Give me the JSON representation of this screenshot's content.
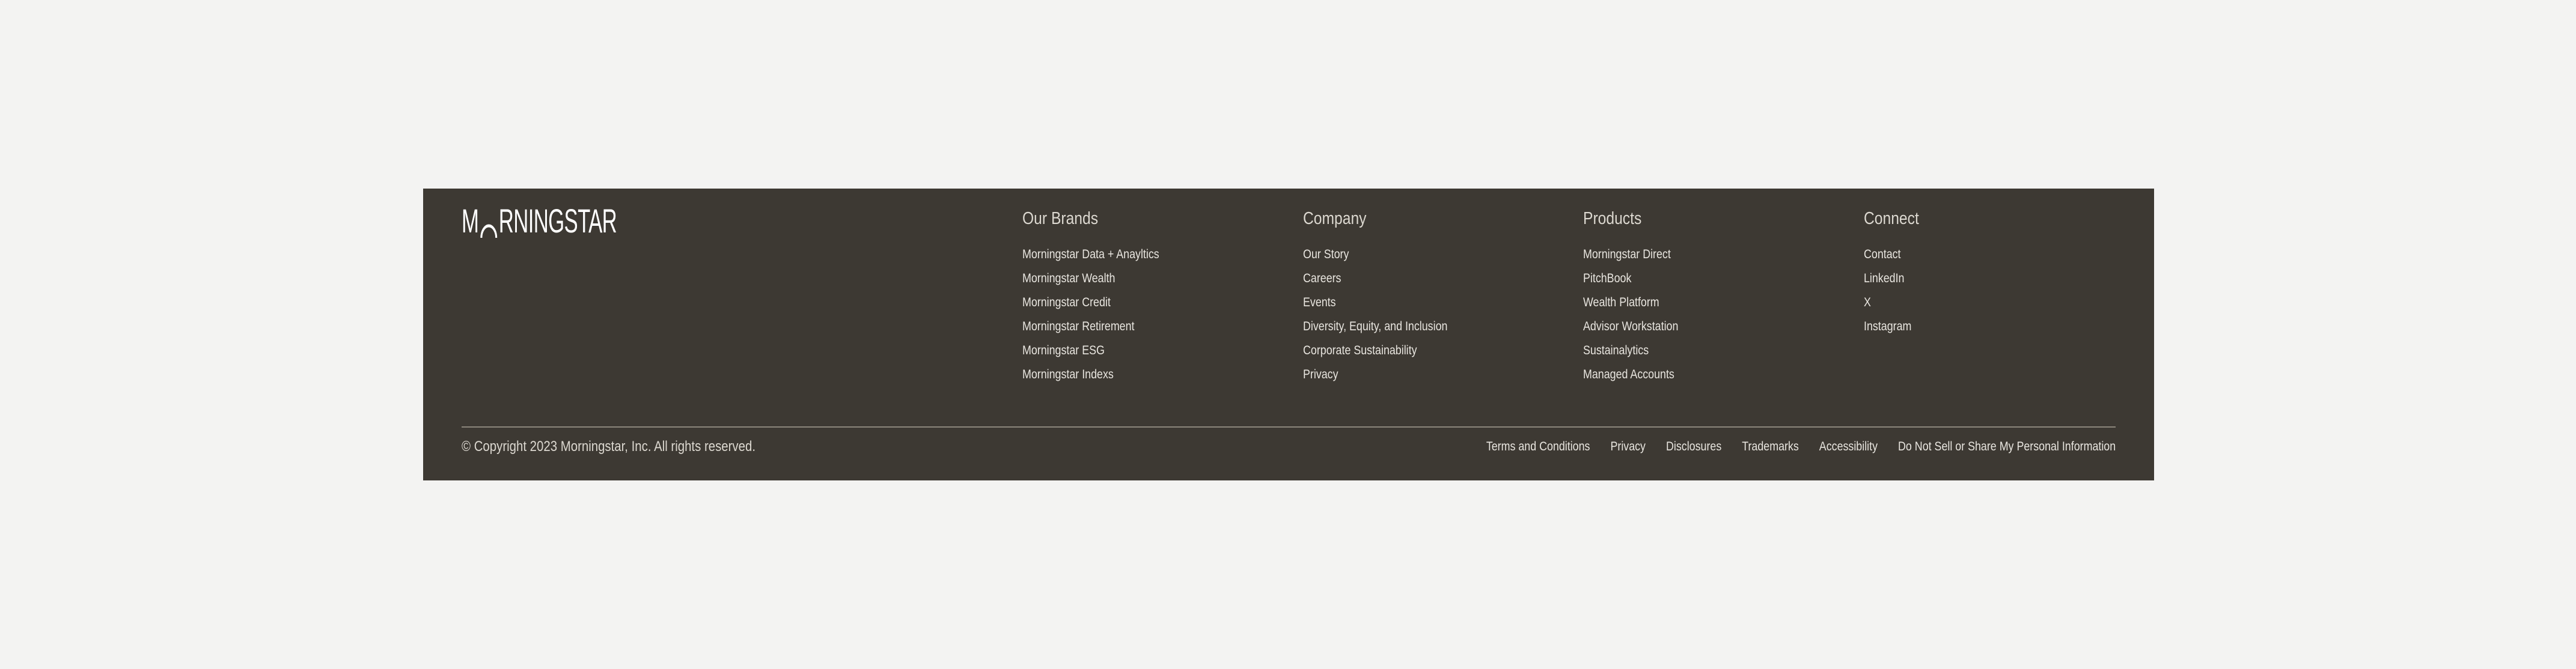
{
  "brand": {
    "logo_text_pre": "M",
    "logo_text_post": "RNINGSTAR",
    "logo_full": "MORNINGSTAR"
  },
  "columns": {
    "brands": {
      "title": "Our Brands",
      "items": [
        "Morningstar Data + Anayltics",
        "Morningstar Wealth",
        "Morningstar Credit",
        "Morningstar Retirement",
        "Morningstar ESG",
        "Morningstar Indexs"
      ]
    },
    "company": {
      "title": "Company",
      "items": [
        "Our Story",
        "Careers",
        "Events",
        "Diversity, Equity, and Inclusion",
        "Corporate Sustainability",
        "Privacy"
      ]
    },
    "products": {
      "title": "Products",
      "items": [
        "Morningstar Direct",
        "PitchBook",
        "Wealth Platform",
        "Advisor Workstation",
        "Sustainalytics",
        "Managed Accounts"
      ]
    },
    "connect": {
      "title": "Connect",
      "items": [
        "Contact",
        "LinkedIn",
        "X",
        "Instagram"
      ]
    }
  },
  "bottom": {
    "copyright": "© Copyright 2023 Morningstar, Inc. All rights reserved.",
    "links": [
      "Terms and Conditions",
      "Privacy",
      "Disclosures",
      "Trademarks",
      "Accessibility",
      "Do Not Sell or Share My Personal Information"
    ]
  },
  "colors": {
    "page_background": "#f3f3f2",
    "footer_background": "#3d3933",
    "footer_text": "#e9e6e0",
    "divider": "#8c867c"
  }
}
